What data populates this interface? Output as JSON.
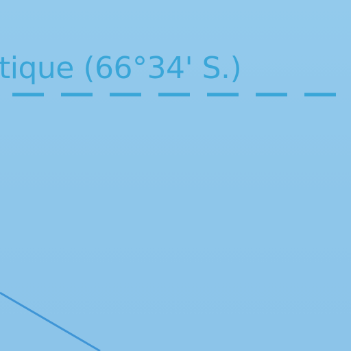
{
  "map": {
    "circle_label": "tique (66°34' S.)",
    "colors": {
      "sea": "#8fc6ea",
      "label": "#3aa6d8",
      "circle_line": "#3aa6d8",
      "boundary_line": "#3f95d6"
    }
  }
}
